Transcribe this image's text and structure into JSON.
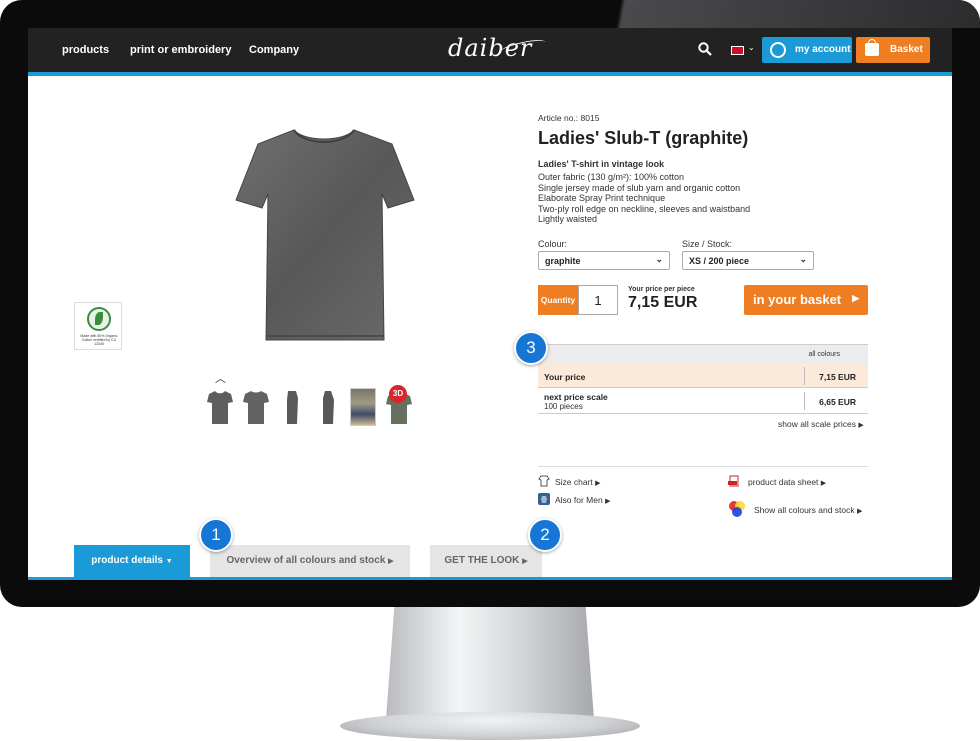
{
  "nav": {
    "products": "products",
    "print": "print or embroidery",
    "company": "Company"
  },
  "logo": "daiber",
  "header": {
    "account_label": "my account",
    "basket_label": "Basket"
  },
  "product": {
    "article_no": "Article no.: 8015",
    "title": "Ladies' Slub-T (graphite)",
    "subtitle": "Ladies' T-shirt in vintage look",
    "features": [
      "Outer fabric (130 g/m²): 100% cotton",
      "Single jersey made of slub yarn and organic cotton",
      "Elaborate Spray Print technique",
      "Two-ply roll edge on neckline, sleeves and waistband",
      "Lightly waisted"
    ],
    "colour_label": "Colour:",
    "colour_value": "graphite",
    "size_label": "Size / Stock:",
    "size_value": "XS / 200 piece",
    "quantity_label": "Quantity",
    "quantity_value": "1",
    "price_label": "Your price per piece",
    "price_value": "7,15 EUR",
    "cart_button": "in your basket"
  },
  "badge": {
    "text": "Made with 50% Organic Cotton certified by CU 12345"
  },
  "badge_3d": "3D",
  "price_table": {
    "header": "all colours",
    "rows": [
      {
        "label": "Your price",
        "sub": "",
        "value": "7,15 EUR"
      },
      {
        "label": "next price scale",
        "sub": "100 pieces",
        "value": "6,65 EUR"
      }
    ],
    "scale_link": "show all scale prices"
  },
  "links": {
    "size_chart": "Size chart",
    "data_sheet": "product data sheet",
    "also_men": "Also for Men",
    "all_colours": "Show all colours and stock"
  },
  "tabs": [
    {
      "label": "product details"
    },
    {
      "label": "Overview of all colours and stock"
    },
    {
      "label": "GET THE LOOK"
    }
  ],
  "callouts": [
    "1",
    "2",
    "3"
  ],
  "colors": {
    "accent": "#1a9ad6",
    "orange": "#ef7d22",
    "header": "#222223"
  }
}
